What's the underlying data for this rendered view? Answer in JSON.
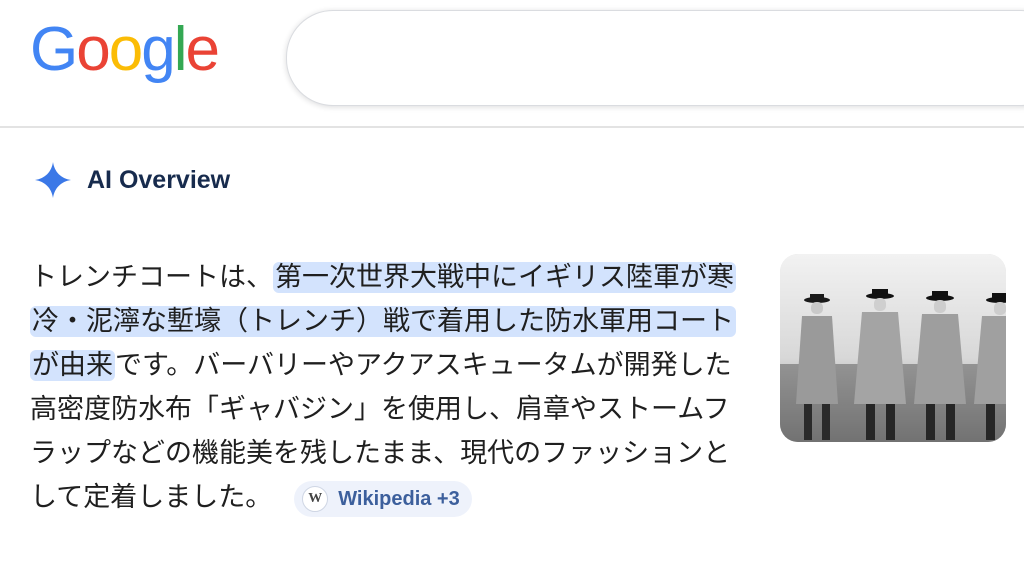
{
  "logo": {
    "letters": [
      "G",
      "o",
      "o",
      "g",
      "l",
      "e"
    ],
    "colors": [
      "#4285f4",
      "#ea4335",
      "#fbbc05",
      "#4285f4",
      "#34a853",
      "#ea4335"
    ]
  },
  "search": {
    "value": ""
  },
  "ai_overview": {
    "title": "AI Overview",
    "icon": "sparkle-icon",
    "icon_color": "#3b78e7",
    "answer": {
      "lead": "トレンチコートは、",
      "highlight": "第一次世界大戦中にイギリス陸軍が寒冷・泥濘な塹壕（トレンチ）戦で着用した防水軍用コートが由来",
      "rest": "です。バーバリーやアクアスキュータムが開発した高密度防水布「ギャバジン」を使用し、肩章やストームフラップなどの機能美を残したまま、現代のファッションとして定着しました。"
    },
    "source_chip": {
      "icon_letter": "W",
      "label": "Wikipedia +3"
    },
    "image": {
      "alt": "trench-coat-men-photo"
    }
  },
  "colors": {
    "highlight": "#d3e3fd",
    "chip_bg": "#eef2fb",
    "chip_text": "#3c5f9c"
  }
}
